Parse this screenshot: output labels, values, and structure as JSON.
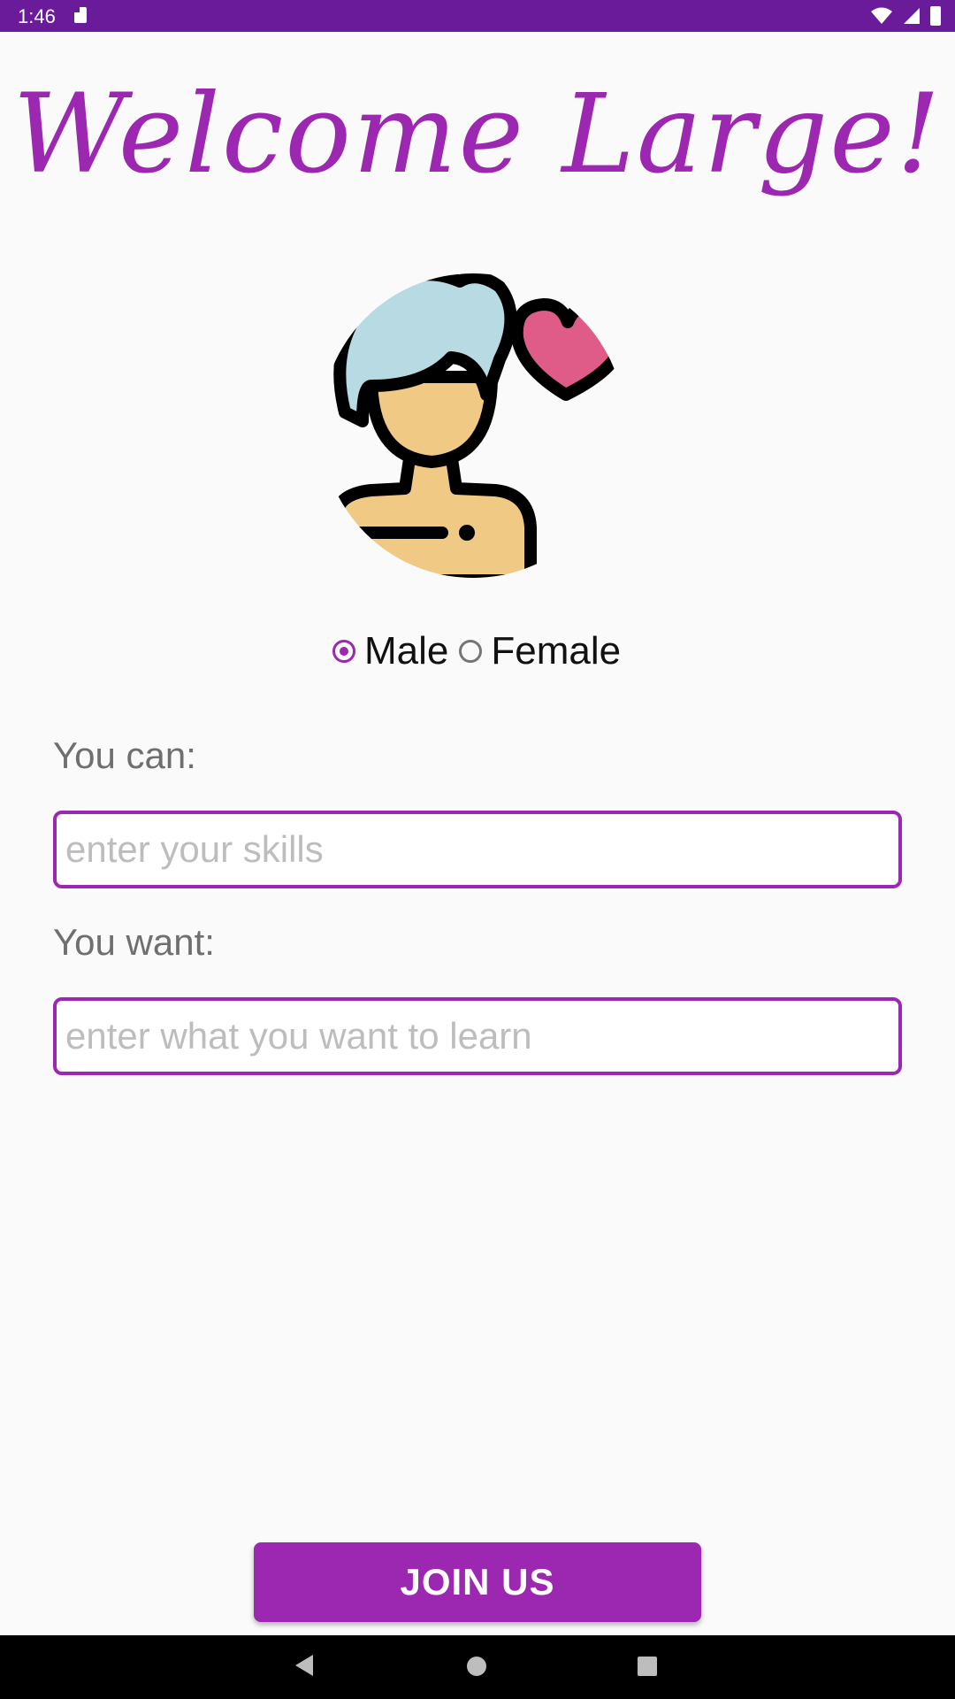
{
  "status_bar": {
    "time": "1:46",
    "icons": [
      "sd-card-icon",
      "wifi-icon",
      "signal-icon",
      "battery-icon"
    ]
  },
  "title": "Welcome Large!",
  "avatar": {
    "icon": "person-with-heart-icon"
  },
  "gender": {
    "options": [
      {
        "label": "Male",
        "checked": true
      },
      {
        "label": "Female",
        "checked": false
      }
    ]
  },
  "skills": {
    "label": "You can:",
    "placeholder": "enter your skills",
    "value": ""
  },
  "wants": {
    "label": "You want:",
    "placeholder": "enter what you want to learn",
    "value": ""
  },
  "join_button": {
    "label": "JOIN US"
  },
  "nav_bar": {
    "icons": [
      "back-icon",
      "home-icon",
      "recents-icon"
    ]
  },
  "colors": {
    "accent": "#9c27b0",
    "status_bar": "#6a1b9a",
    "background": "#fafafa"
  }
}
